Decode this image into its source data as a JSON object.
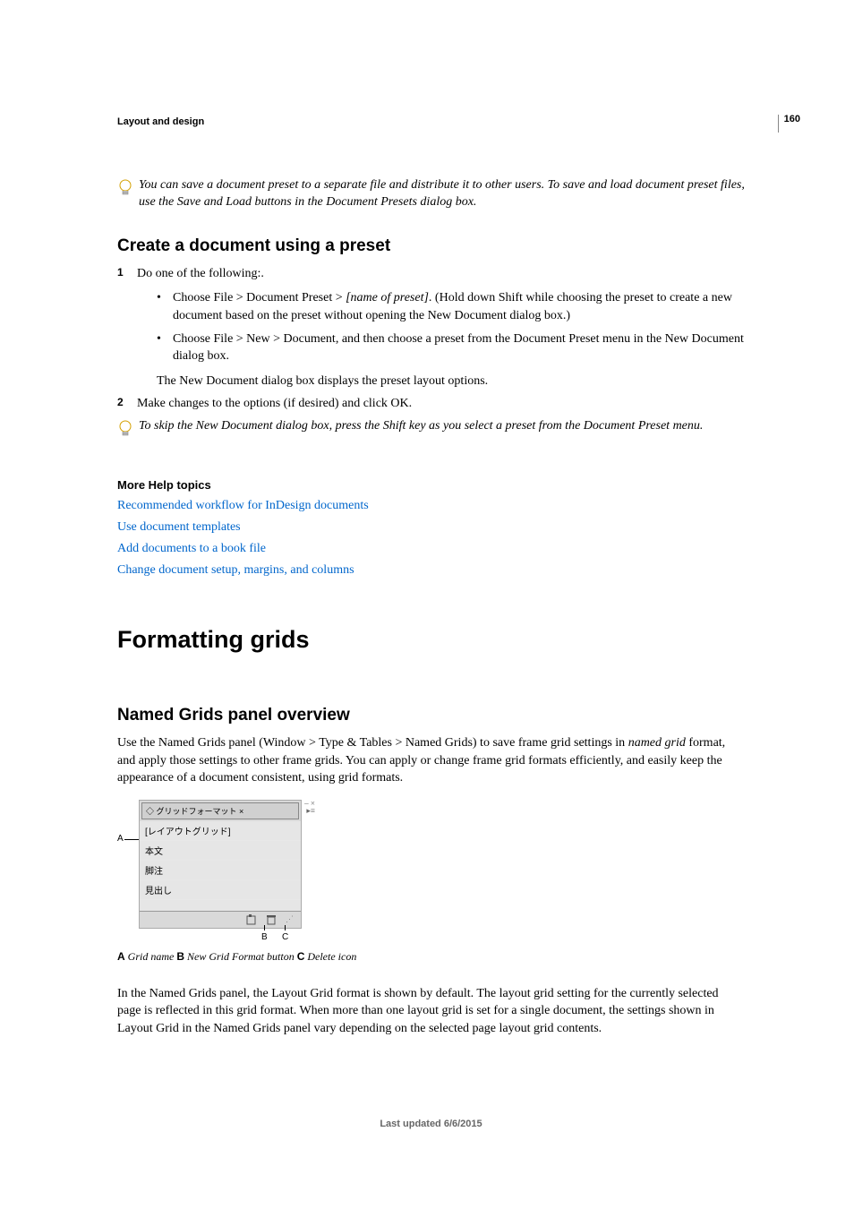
{
  "page_number": "160",
  "section_header": "Layout and design",
  "tip1": "You can save a document preset to a separate file and distribute it to other users. To save and load document preset files, use the Save and Load buttons in the Document Presets dialog box.",
  "heading_create": "Create a document using a preset",
  "step1": "Do one of the following:.",
  "bullet1_pre": "Choose File > Document Preset > ",
  "bullet1_em": "[name of preset]",
  "bullet1_post": ". (Hold down Shift while choosing the preset to create a new document based on the preset without opening the New Document dialog box.)",
  "bullet2": "Choose File > New > Document, and then choose a preset from the Document Preset menu in the New Document dialog box.",
  "step1_after": "The New Document dialog box displays the preset layout options.",
  "step2": "Make changes to the options (if desired) and click OK.",
  "tip2": "To skip the New Document dialog box, press the Shift key as you select a preset from the Document Preset menu.",
  "more_heading": "More Help topics",
  "links": [
    "Recommended workflow for InDesign documents",
    "Use document templates",
    "Add documents to a book file",
    "Change document setup, margins, and columns"
  ],
  "h1_formatting": "Formatting grids",
  "heading_overview": "Named Grids panel overview",
  "overview_p1_pre": "Use the Named Grids panel (Window > Type & Tables > Named Grids) to save frame grid settings in ",
  "overview_p1_em": "named grid",
  "overview_p1_post": " format, and apply those settings to other frame grids. You can apply or change frame grid formats efficiently, and easily keep the appearance of a document consistent, using grid formats.",
  "panel": {
    "title": "グリッドフォーマット",
    "rows": [
      "[レイアウトグリッド]",
      "本文",
      "脚注",
      "見出し"
    ]
  },
  "caption": {
    "a_label": "A",
    "a_text": " Grid name  ",
    "b_label": "B",
    "b_text": " New Grid Format button  ",
    "c_label": "C",
    "c_text": " Delete icon"
  },
  "overview_p2": "In the Named Grids panel, the Layout Grid format is shown by default. The layout grid setting for the currently selected page is reflected in this grid format. When more than one layout grid is set for a single document, the settings shown in Layout Grid in the Named Grids panel vary depending on the selected page layout grid contents.",
  "footer": "Last updated 6/6/2015",
  "figure_labels": {
    "A": "A",
    "B": "B",
    "C": "C"
  }
}
